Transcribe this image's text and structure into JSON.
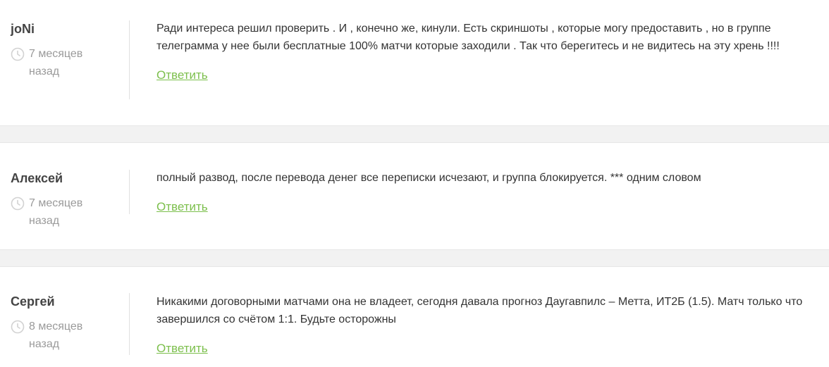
{
  "comments": [
    {
      "author": "joNi",
      "date_line1": "7 месяцев",
      "date_line2": "назад",
      "text": "Ради интереса решил проверить . И , конечно же, кинули. Есть скриншоты , которые могу предоставить , но в группе телеграмма у нее были бесплатные 100% матчи которые заходили . Так что берегитесь и не видитесь на эту хрень !!!!",
      "reply_label": "Ответить"
    },
    {
      "author": "Алексей",
      "date_line1": "7 месяцев",
      "date_line2": "назад",
      "text": "полный развод, после перевода денег все переписки исчезают, и группа блокируется. *** одним словом",
      "reply_label": "Ответить"
    },
    {
      "author": "Сергей",
      "date_line1": "8 месяцев",
      "date_line2": "назад",
      "text": "Никакими договорными матчами она не владеет, сегодня давала прогноз Даугавпилс – Метта, ИТ2Б (1.5). Матч только что завершился со счётом 1:1. Будьте осторожны",
      "reply_label": "Ответить"
    }
  ],
  "icons": {
    "clock": "clock-icon"
  },
  "colors": {
    "reply_link": "#7cbf4c",
    "separator": "#f2f2f2",
    "date_text": "#9a9a9a"
  }
}
